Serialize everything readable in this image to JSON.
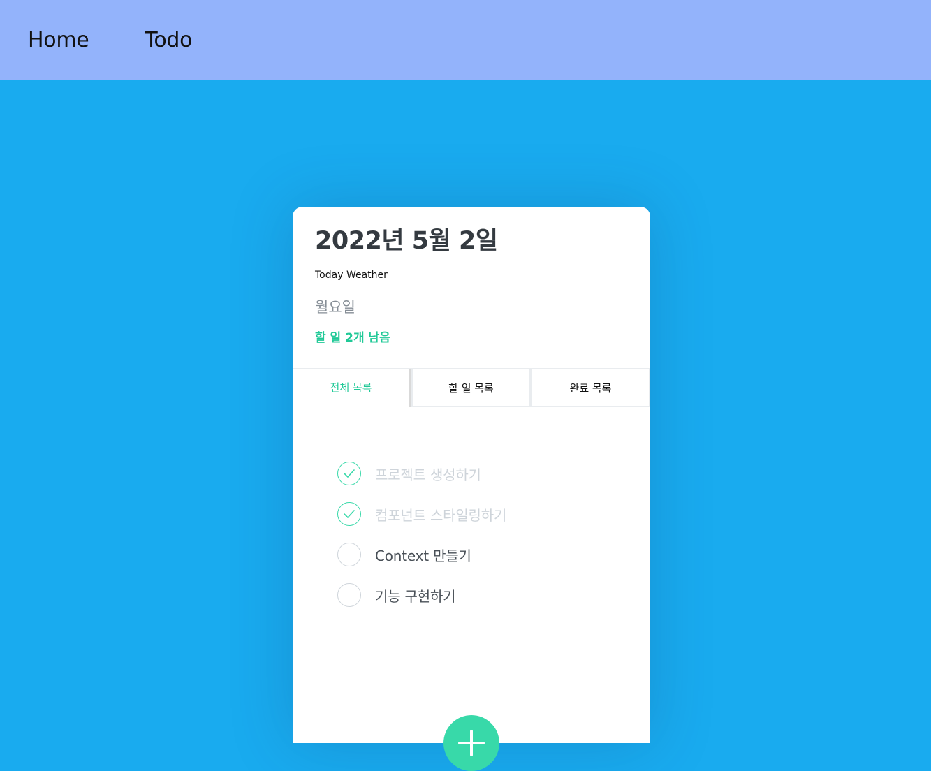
{
  "nav": {
    "items": [
      {
        "label": "Home"
      },
      {
        "label": "Todo"
      }
    ]
  },
  "card": {
    "date": "2022년 5월 2일",
    "weather": "Today Weather",
    "weekday": "월요일",
    "tasks_left": "할 일 2개 남음",
    "tabs": [
      {
        "label": "전체 목록",
        "active": true
      },
      {
        "label": "할 일 목록",
        "active": false
      },
      {
        "label": "완료 목록",
        "active": false
      }
    ],
    "todos": [
      {
        "text": "프로젝트 생성하기",
        "done": true
      },
      {
        "text": "컴포넌트 스타일링하기",
        "done": true
      },
      {
        "text": "Context 만들기",
        "done": false
      },
      {
        "text": "기능 구현하기",
        "done": false
      }
    ]
  },
  "add_button": {
    "icon": "plus-icon"
  },
  "colors": {
    "background": "#19abef",
    "nav_background": "#93b3fb",
    "accent": "#38d9a9",
    "accent_text": "#20c997"
  }
}
